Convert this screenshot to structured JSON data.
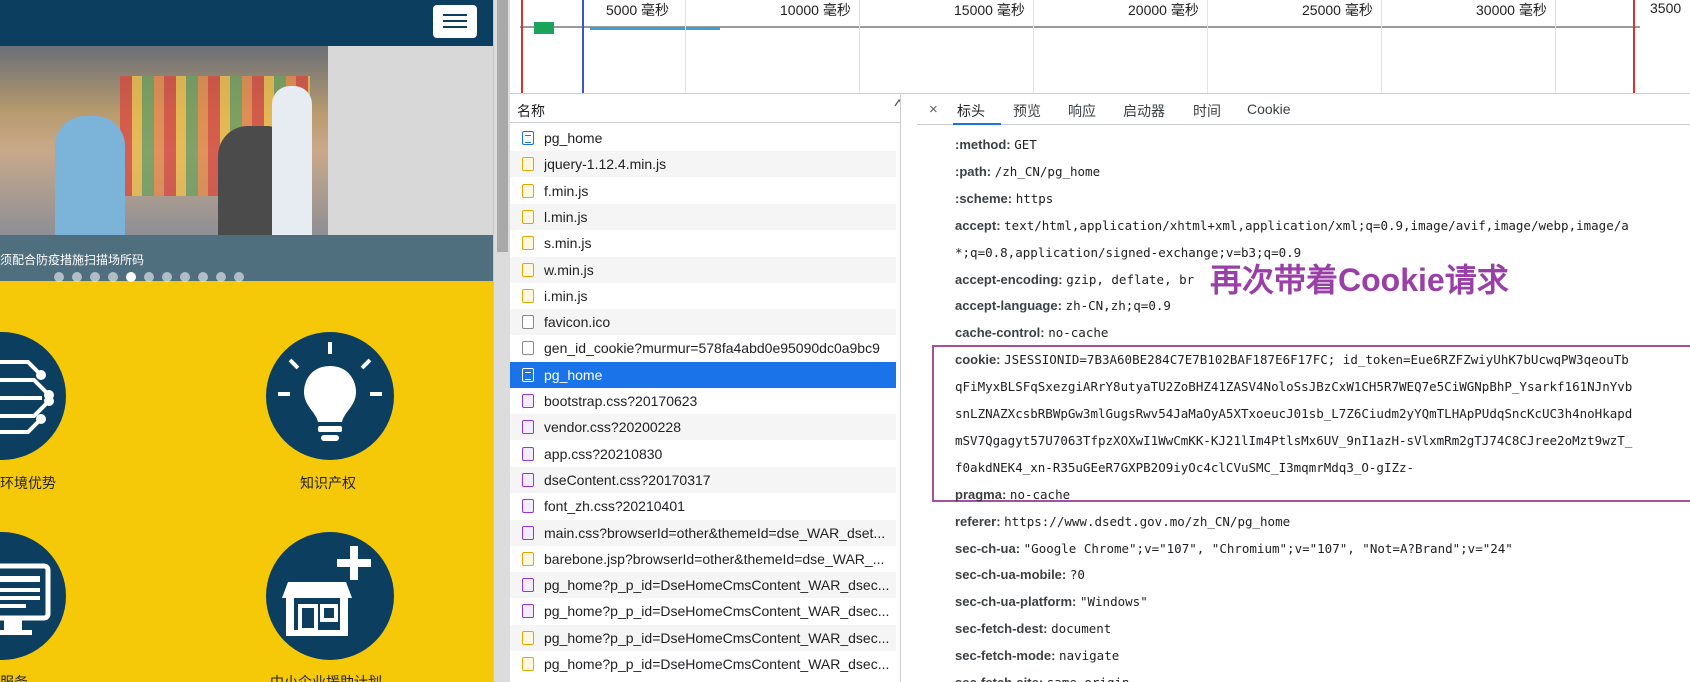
{
  "website": {
    "slide_caption": "须配合防疫措施扫描场所码",
    "features": [
      {
        "label": "环境优势"
      },
      {
        "label": "知识产权"
      },
      {
        "label": "服务"
      },
      {
        "label": "中小企业援助计划"
      }
    ]
  },
  "timeline": {
    "ticks": [
      "5000 毫秒",
      "10000 毫秒",
      "15000 毫秒",
      "20000 毫秒",
      "25000 毫秒",
      "30000 毫秒",
      "3500"
    ]
  },
  "network": {
    "column_header": "名称",
    "requests": [
      {
        "name": "pg_home",
        "type": "doc"
      },
      {
        "name": "jquery-1.12.4.min.js",
        "type": "js"
      },
      {
        "name": "f.min.js",
        "type": "js"
      },
      {
        "name": "l.min.js",
        "type": "js"
      },
      {
        "name": "s.min.js",
        "type": "js"
      },
      {
        "name": "w.min.js",
        "type": "js"
      },
      {
        "name": "i.min.js",
        "type": "js"
      },
      {
        "name": "favicon.ico",
        "type": "blank"
      },
      {
        "name": "gen_id_cookie?murmur=578fa4abd0e95090dc0a9bc9",
        "type": "blank"
      },
      {
        "name": "pg_home",
        "type": "doc",
        "selected": true
      },
      {
        "name": "bootstrap.css?20170623",
        "type": "css"
      },
      {
        "name": "vendor.css?20200228",
        "type": "css"
      },
      {
        "name": "app.css?20210830",
        "type": "css"
      },
      {
        "name": "dseContent.css?20170317",
        "type": "css"
      },
      {
        "name": "font_zh.css?20210401",
        "type": "css"
      },
      {
        "name": "main.css?browserId=other&themeId=dse_WAR_dset...",
        "type": "css"
      },
      {
        "name": "barebone.jsp?browserId=other&themeId=dse_WAR_...",
        "type": "js"
      },
      {
        "name": "pg_home?p_p_id=DseHomeCmsContent_WAR_dsec...",
        "type": "css"
      },
      {
        "name": "pg_home?p_p_id=DseHomeCmsContent_WAR_dsec...",
        "type": "css"
      },
      {
        "name": "pg_home?p_p_id=DseHomeCmsContent_WAR_dsec...",
        "type": "js"
      },
      {
        "name": "pg_home?p_p_id=DseHomeCmsContent_WAR_dsec...",
        "type": "js"
      }
    ]
  },
  "detail": {
    "close": "×",
    "tabs": [
      "标头",
      "预览",
      "响应",
      "启动器",
      "时间",
      "Cookie"
    ],
    "headers": [
      {
        "k": ":method:",
        "v": "GET"
      },
      {
        "k": ":path:",
        "v": "/zh_CN/pg_home"
      },
      {
        "k": ":scheme:",
        "v": "https"
      },
      {
        "k": "accept:",
        "v": "text/html,application/xhtml+xml,application/xml;q=0.9,image/avif,image/webp,image/a"
      },
      {
        "k": "",
        "v": "*;q=0.8,application/signed-exchange;v=b3;q=0.9"
      },
      {
        "k": "accept-encoding:",
        "v": "gzip, deflate, br"
      },
      {
        "k": "accept-language:",
        "v": "zh-CN,zh;q=0.9"
      },
      {
        "k": "cache-control:",
        "v": "no-cache"
      },
      {
        "k": "cookie:",
        "v": "JSESSIONID=7B3A60BE284C7E7B102BAF187E6F17FC; id_token=Eue6RZFZwiyUhK7bUcwqPW3qeouTb"
      },
      {
        "k": "",
        "v": "qFiMyxBLSFqSxezgiARrY8utyaTU2ZoBHZ41ZASV4NoloSsJBzCxW1CH5R7WEQ7e5CiWGNpBhP_Ysarkf161NJnYvb"
      },
      {
        "k": "",
        "v": "snLZNAZXcsbRBWpGw3mlGugsRwv54JaMaOyA5XTxoeucJ01sb_L7Z6Ciudm2yYQmTLHApPUdqSncKcUC3h4noHkapd"
      },
      {
        "k": "",
        "v": "mSV7Qgagyt57U7063TfpzXOXwI1WwCmKK-KJ21lIm4PtlsMx6UV_9nI1azH-sVlxmRm2gTJ74C8CJree2oMzt9wzT_"
      },
      {
        "k": "",
        "v": "f0akdNEK4_xn-R35uGEeR7GXPB2O9iyOc4clCVuSMC_I3mqmrMdq3_O-gIZz-"
      },
      {
        "k": "pragma:",
        "v": "no-cache"
      },
      {
        "k": "referer:",
        "v": "https://www.dsedt.gov.mo/zh_CN/pg_home"
      },
      {
        "k": "sec-ch-ua:",
        "v": "\"Google Chrome\";v=\"107\", \"Chromium\";v=\"107\", \"Not=A?Brand\";v=\"24\""
      },
      {
        "k": "sec-ch-ua-mobile:",
        "v": "?0"
      },
      {
        "k": "sec-ch-ua-platform:",
        "v": "\"Windows\""
      },
      {
        "k": "sec-fetch-dest:",
        "v": "document"
      },
      {
        "k": "sec-fetch-mode:",
        "v": "navigate"
      },
      {
        "k": "sec-fetch-site:",
        "v": "same-origin"
      }
    ]
  },
  "annotation": "再次带着Cookie请求",
  "colors": {
    "site_header": "#0c3f5f",
    "site_background": "#f6c908",
    "selection": "#1a73e8",
    "annotation": "#9b3fa8",
    "cookie_box": "#a64ea0"
  }
}
